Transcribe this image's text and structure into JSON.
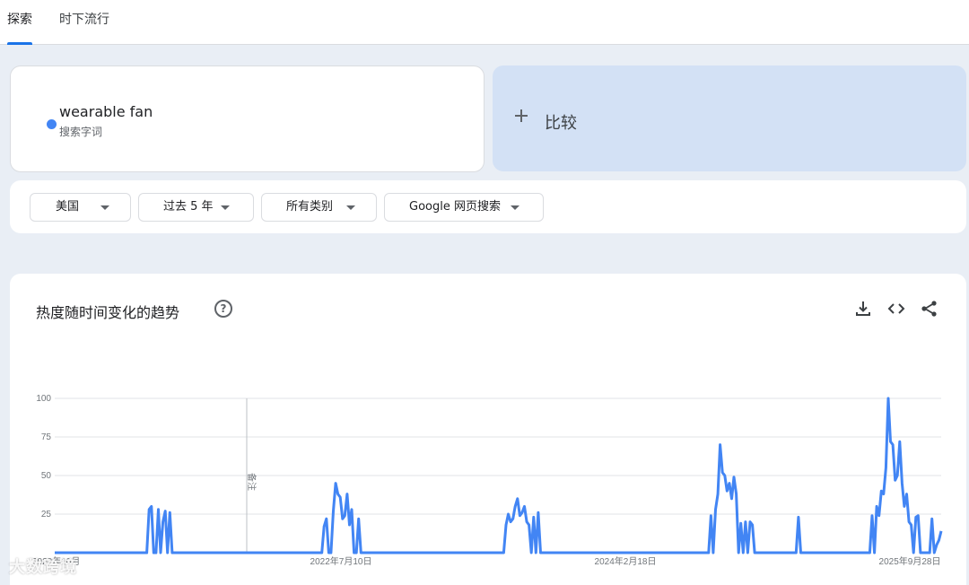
{
  "nav": {
    "tabs": [
      {
        "label": "探索",
        "active": true
      },
      {
        "label": "时下流行",
        "active": false
      }
    ]
  },
  "search_term": {
    "name": "wearable fan",
    "type": "搜索字词",
    "color": "#4285f4"
  },
  "compare": {
    "label": "比较"
  },
  "filters": {
    "region": "美国",
    "time": "过去 5 年",
    "category": "所有类别",
    "source": "Google 网页搜索"
  },
  "trend_card": {
    "title": "热度随时间变化的趋势",
    "note_label": "备注"
  },
  "watermark": "大数跨境",
  "chart_data": {
    "type": "line",
    "title": "热度随时间变化的趋势",
    "x_tick_labels": [
      "2020年10月",
      "2022年7月10日",
      "2024年2月18日",
      "2025年9月28日"
    ],
    "y_ticks": [
      25,
      50,
      75,
      100
    ],
    "ylim": [
      0,
      100
    ],
    "grid": true,
    "series": [
      {
        "name": "wearable fan",
        "color": "#4285f4",
        "values": [
          0,
          0,
          0,
          0,
          0,
          0,
          0,
          0,
          0,
          0,
          0,
          0,
          0,
          0,
          0,
          0,
          0,
          0,
          0,
          0,
          0,
          0,
          0,
          0,
          0,
          0,
          0,
          0,
          0,
          0,
          0,
          0,
          0,
          0,
          0,
          0,
          0,
          0,
          0,
          0,
          0,
          28,
          30,
          0,
          0,
          28,
          0,
          20,
          27,
          0,
          26,
          0,
          0,
          0,
          0,
          0,
          0,
          0,
          0,
          0,
          0,
          0,
          0,
          0,
          0,
          0,
          0,
          0,
          0,
          0,
          0,
          0,
          0,
          0,
          0,
          0,
          0,
          0,
          0,
          0,
          0,
          0,
          0,
          0,
          0,
          0,
          0,
          0,
          0,
          0,
          0,
          0,
          0,
          0,
          0,
          0,
          0,
          0,
          0,
          0,
          0,
          0,
          0,
          0,
          0,
          0,
          0,
          0,
          0,
          0,
          0,
          0,
          0,
          0,
          0,
          0,
          0,
          17,
          22,
          0,
          0,
          27,
          45,
          38,
          36,
          22,
          24,
          38,
          18,
          28,
          0,
          0,
          22,
          0,
          0,
          0,
          0,
          0,
          0,
          0,
          0,
          0,
          0,
          0,
          0,
          0,
          0,
          0,
          0,
          0,
          0,
          0,
          0,
          0,
          0,
          0,
          0,
          0,
          0,
          0,
          0,
          0,
          0,
          0,
          0,
          0,
          0,
          0,
          0,
          0,
          0,
          0,
          0,
          0,
          0,
          0,
          0,
          0,
          0,
          0,
          0,
          0,
          0,
          0,
          0,
          0,
          0,
          0,
          0,
          0,
          0,
          0,
          0,
          0,
          0,
          0,
          18,
          25,
          20,
          22,
          30,
          35,
          24,
          26,
          30,
          20,
          18,
          0,
          23,
          0,
          26,
          0,
          0,
          0,
          0,
          0,
          0,
          0,
          0,
          0,
          0,
          0,
          0,
          0,
          0,
          0,
          0,
          0,
          0,
          0,
          0,
          0,
          0,
          0,
          0,
          0,
          0,
          0,
          0,
          0,
          0,
          0,
          0,
          0,
          0,
          0,
          0,
          0,
          0,
          0,
          0,
          0,
          0,
          0,
          0,
          0,
          0,
          0,
          0,
          0,
          0,
          0,
          0,
          0,
          0,
          0,
          0,
          0,
          0,
          0,
          0,
          0,
          0,
          0,
          0,
          0,
          0,
          0,
          0,
          0,
          0,
          0,
          0,
          0,
          0,
          24,
          0,
          28,
          38,
          70,
          52,
          50,
          40,
          45,
          35,
          49,
          38,
          0,
          19,
          0,
          20,
          0,
          20,
          18,
          0,
          0,
          0,
          0,
          0,
          0,
          0,
          0,
          0,
          0,
          0,
          0,
          0,
          0,
          0,
          0,
          0,
          0,
          0,
          23,
          0,
          0,
          0,
          0,
          0,
          0,
          0,
          0,
          0,
          0,
          0,
          0,
          0,
          0,
          0,
          0,
          0,
          0,
          0,
          0,
          0,
          0,
          0,
          0,
          0,
          0,
          0,
          0,
          0,
          0,
          0,
          24,
          0,
          30,
          24,
          40,
          38,
          55,
          100,
          72,
          70,
          47,
          50,
          72,
          45,
          30,
          38,
          20,
          18,
          0,
          23,
          24,
          0,
          0,
          0,
          0,
          0,
          22,
          0,
          5,
          8,
          14
        ]
      }
    ]
  }
}
